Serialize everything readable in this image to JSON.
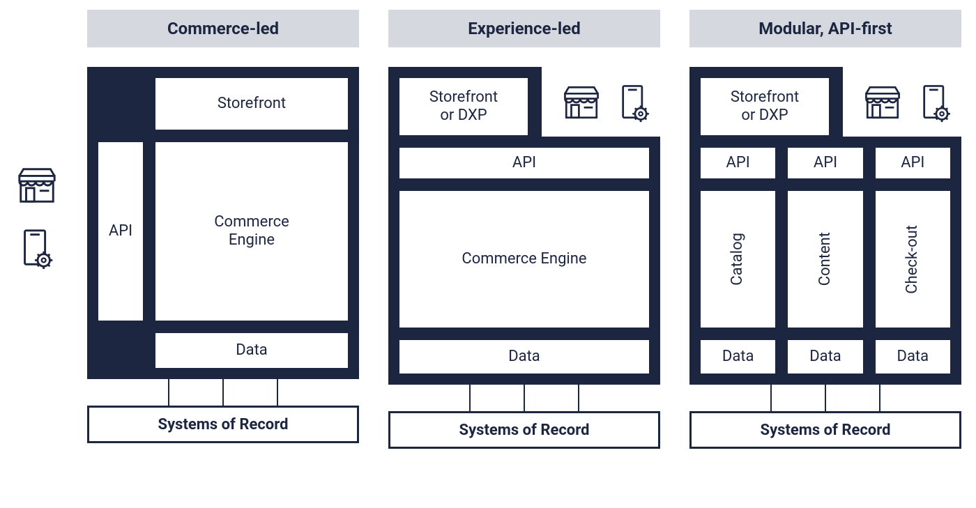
{
  "side_icons": [
    "storefront-icon",
    "device-gear-icon"
  ],
  "columns": [
    {
      "title": "Commerce-led",
      "storefront": "Storefront",
      "api": "API",
      "engine": "Commerce\nEngine",
      "data": "Data",
      "systems": "Systems of Record"
    },
    {
      "title": "Experience-led",
      "storefront": "Storefront\nor DXP",
      "api": "API",
      "engine": "Commerce Engine",
      "data": "Data",
      "systems": "Systems of Record",
      "ext_icons": [
        "storefront-icon",
        "device-gear-icon"
      ]
    },
    {
      "title": "Modular, API-first",
      "storefront": "Storefront\nor DXP",
      "modules": [
        {
          "api": "API",
          "name": "Catalog",
          "data": "Data"
        },
        {
          "api": "API",
          "name": "Content",
          "data": "Data"
        },
        {
          "api": "API",
          "name": "Check-out",
          "data": "Data"
        }
      ],
      "systems": "Systems of Record",
      "ext_icons": [
        "storefront-icon",
        "device-gear-icon"
      ]
    }
  ]
}
